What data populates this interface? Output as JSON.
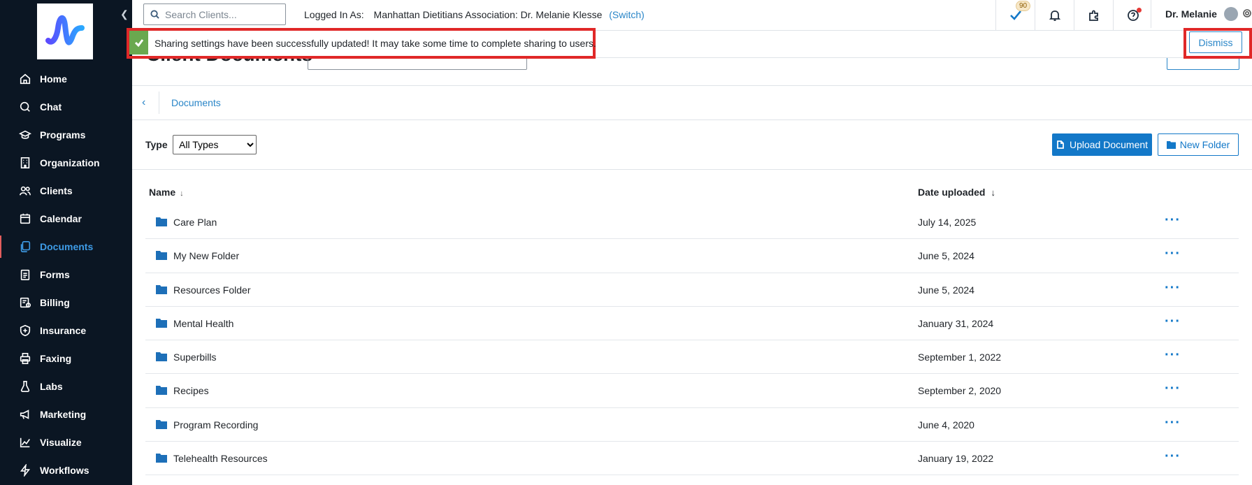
{
  "sidebar": {
    "logo_alt": "logo",
    "items": [
      {
        "label": "Home",
        "icon": "home-icon"
      },
      {
        "label": "Chat",
        "icon": "chat-icon"
      },
      {
        "label": "Programs",
        "icon": "graduation-cap-icon"
      },
      {
        "label": "Organization",
        "icon": "building-icon"
      },
      {
        "label": "Clients",
        "icon": "users-icon"
      },
      {
        "label": "Calendar",
        "icon": "calendar-icon"
      },
      {
        "label": "Documents",
        "icon": "documents-icon",
        "active": true
      },
      {
        "label": "Forms",
        "icon": "clipboard-icon"
      },
      {
        "label": "Billing",
        "icon": "billing-icon"
      },
      {
        "label": "Insurance",
        "icon": "shield-icon"
      },
      {
        "label": "Faxing",
        "icon": "printer-icon"
      },
      {
        "label": "Labs",
        "icon": "flask-icon"
      },
      {
        "label": "Marketing",
        "icon": "megaphone-icon"
      },
      {
        "label": "Visualize",
        "icon": "chart-icon"
      },
      {
        "label": "Workflows",
        "icon": "lightning-icon"
      }
    ]
  },
  "topbar": {
    "search_placeholder": "Search Clients...",
    "logged_label": "Logged In As:",
    "logged_org": "Manhattan Dietitians Association: Dr. Melanie Klesse",
    "switch_label": "(Switch)",
    "tasks_badge": "90",
    "user_name": "Dr. Melanie"
  },
  "banner": {
    "message": "Sharing settings have been successfully updated! It may take some time to complete sharing to users.",
    "dismiss_label": "Dismiss"
  },
  "page": {
    "title": "Client Documents"
  },
  "breadcrumb": {
    "back_glyph": "‹",
    "current": "Documents"
  },
  "toolbar": {
    "type_label": "Type",
    "type_selected": "All Types",
    "upload_label": "Upload Document",
    "new_folder_label": "New Folder"
  },
  "table": {
    "columns": {
      "name": "Name",
      "date": "Date uploaded"
    },
    "rows": [
      {
        "name": "Care Plan",
        "date": "July 14, 2025"
      },
      {
        "name": "My New Folder",
        "date": "June 5, 2024"
      },
      {
        "name": "Resources Folder",
        "date": "June 5, 2024"
      },
      {
        "name": "Mental Health",
        "date": "January 31, 2024"
      },
      {
        "name": "Superbills",
        "date": "September 1, 2022"
      },
      {
        "name": "Recipes",
        "date": "September 2, 2020"
      },
      {
        "name": "Program Recording",
        "date": "June 4, 2020"
      },
      {
        "name": "Telehealth Resources",
        "date": "January 19, 2022"
      }
    ]
  },
  "colors": {
    "sidebar_bg": "#0b1623",
    "accent": "#1378c8",
    "success": "#6aa84f",
    "highlight": "#e02828"
  }
}
